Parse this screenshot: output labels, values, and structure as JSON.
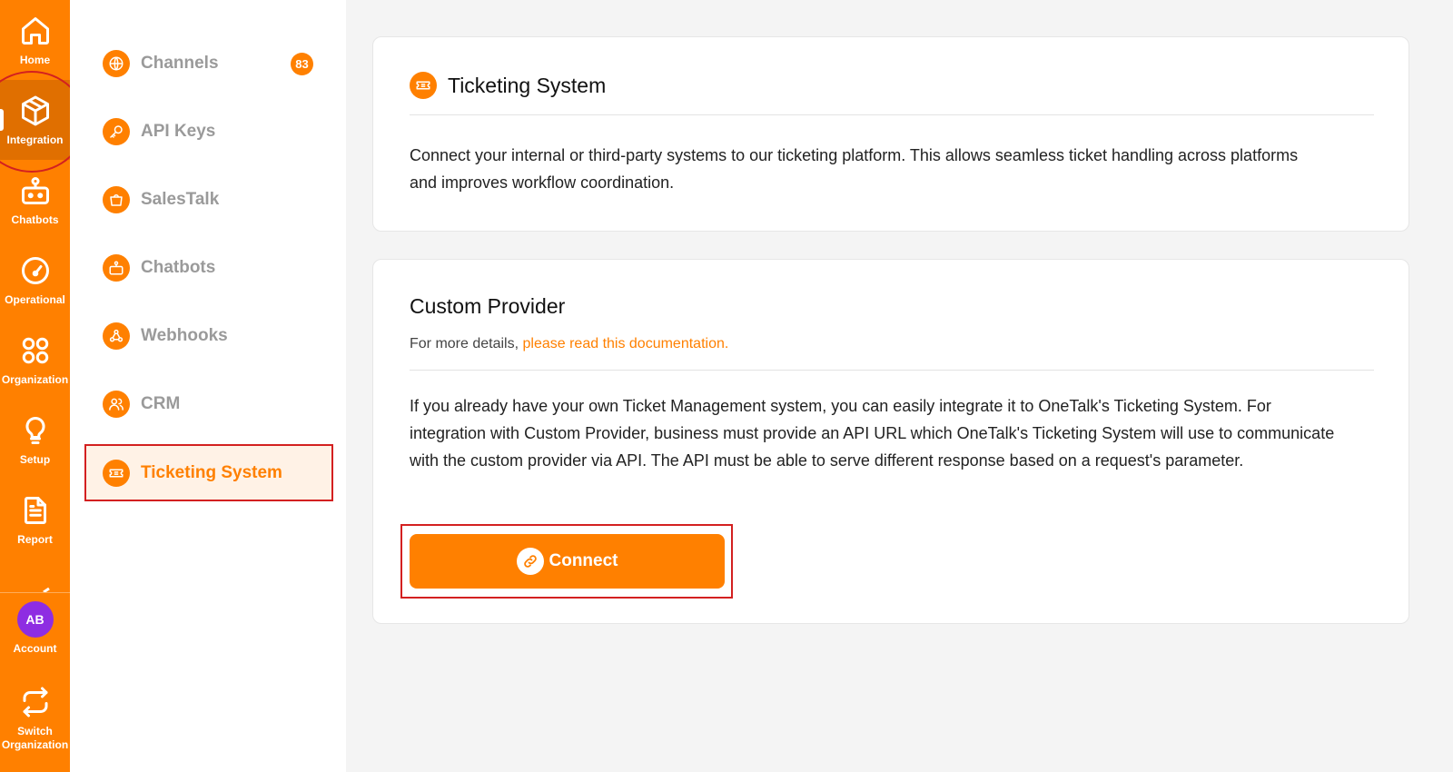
{
  "rail": {
    "items": [
      {
        "label": "Home",
        "icon": "home-icon"
      },
      {
        "label": "Integration",
        "icon": "integration-icon"
      },
      {
        "label": "Chatbots",
        "icon": "robot-icon"
      },
      {
        "label": "Operational",
        "icon": "gauge-icon"
      },
      {
        "label": "Organization",
        "icon": "organization-icon"
      },
      {
        "label": "Setup",
        "icon": "bulb-icon"
      },
      {
        "label": "Report",
        "icon": "report-icon"
      }
    ],
    "account": {
      "initials": "AB",
      "label": "Account"
    },
    "switch": {
      "label_line1": "Switch",
      "label_line2": "Organization",
      "icon": "switch-icon"
    }
  },
  "subnav": {
    "items": [
      {
        "label": "Channels",
        "badge": "83",
        "icon": "globe-icon"
      },
      {
        "label": "API Keys",
        "icon": "key-icon"
      },
      {
        "label": "SalesTalk",
        "icon": "shopping-bag-icon"
      },
      {
        "label": "Chatbots",
        "icon": "robot-icon"
      },
      {
        "label": "Webhooks",
        "icon": "webhook-icon"
      },
      {
        "label": "CRM",
        "icon": "users-icon"
      },
      {
        "label": "Ticketing System",
        "icon": "ticket-icon"
      }
    ]
  },
  "intro": {
    "title": "Ticketing System",
    "description": "Connect your internal or third-party systems to our ticketing platform. This allows seamless ticket handling across platforms and improves workflow coordination."
  },
  "provider": {
    "title": "Custom Provider",
    "subtitle_prefix": "For more details,",
    "doc_link": "please read this documentation.",
    "body": "If you already have your own Ticket Management system, you can easily integrate it to OneTalk's Ticketing System. For integration with Custom Provider, business must provide an API URL which OneTalk's Ticketing System will use to communicate with the custom provider via API. The API must be able to serve different response based on a request's parameter.",
    "connect_label": "Connect"
  },
  "colors": {
    "accent": "#ff8000",
    "annotation": "#d32020",
    "avatar": "#8e2de2"
  }
}
